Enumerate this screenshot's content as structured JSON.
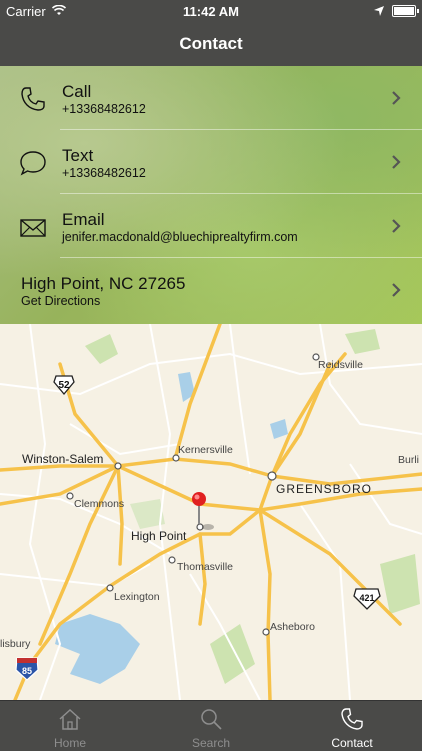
{
  "status": {
    "carrier": "Carrier",
    "time": "11:42 AM"
  },
  "nav": {
    "title": "Contact"
  },
  "contacts": [
    {
      "label": "Call",
      "sub": "+13368482612",
      "icon": "phone-icon"
    },
    {
      "label": "Text",
      "sub": "+13368482612",
      "icon": "chat-bubble-icon"
    },
    {
      "label": "Email",
      "sub": "jenifer.macdonald@bluechiprealtyfirm.com",
      "icon": "envelope-icon"
    }
  ],
  "address": {
    "line": "High Point, NC 27265",
    "sub": "Get Directions"
  },
  "map": {
    "labels": {
      "reidsville": "Reidsville",
      "kernersville": "Kernersville",
      "winston_salem": "Winston-Salem",
      "greensboro": "GREENSBORO",
      "clemmons": "Clemmons",
      "high_point": "High Point",
      "thomasville": "Thomasville",
      "lexington": "Lexington",
      "asheboro": "Asheboro",
      "salisbury": "lisbury",
      "burlington": "Burli"
    },
    "shields": {
      "us52": "52",
      "us421": "421",
      "i85": "85"
    }
  },
  "tabs": [
    {
      "label": "Home",
      "icon": "home-icon"
    },
    {
      "label": "Search",
      "icon": "search-icon"
    },
    {
      "label": "Contact",
      "icon": "phone-icon",
      "active": true
    }
  ],
  "colors": {
    "bar": "#4a4a48",
    "road_major": "#f6c24a",
    "road_minor": "#ffffff",
    "water": "#a9cfe8",
    "park": "#cde3b0",
    "pin": "#e02020"
  }
}
